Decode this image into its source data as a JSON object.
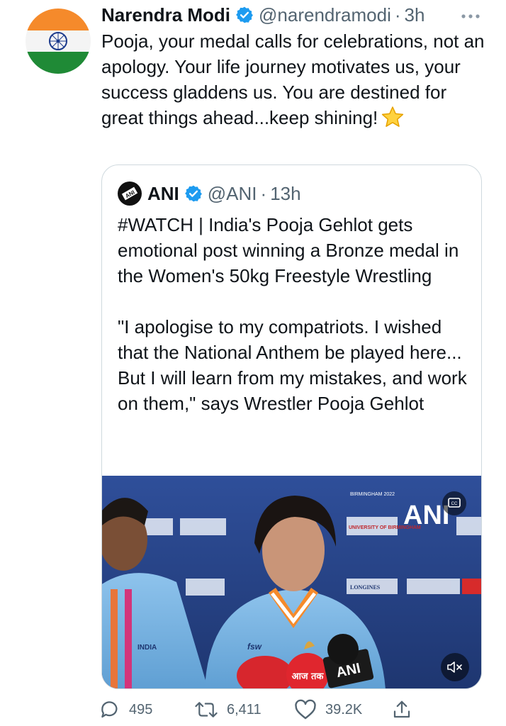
{
  "author": {
    "name": "Narendra Modi",
    "handle": "@narendramodi",
    "separator": "·",
    "time": "3h",
    "more_icon": "ellipsis-icon",
    "avatar": "india-flag-avatar"
  },
  "tweet": {
    "text": "Pooja, your medal calls for celebrations, not an apology. Your life journey motivates us, your success gladdens us. You are destined for great things ahead...keep shining!",
    "emoji": "star-emoji"
  },
  "quote": {
    "name": "ANI",
    "handle": "@ANI",
    "separator": "·",
    "time": "13h",
    "paragraph1": "#WATCH | India's Pooja Gehlot gets emotional post winning a Bronze medal in the Women's 50kg Freestyle Wrestling",
    "paragraph2": "\"I apologise to my compatriots. I wished that the National Anthem be played here... But I will learn from my mistakes, and work on them,\" says Wrestler Pooja Gehlot",
    "media": {
      "watermark": "ANI",
      "mic_label": "ANI",
      "mic_label_2": "आज तक",
      "backdrop_texts": [
        "BIRMINGHAM 2022",
        "UNIVERSITY OF BIRMINGHAM",
        "LONGINES",
        "INDIA",
        "fsw"
      ],
      "captions_icon": "closed-captions-icon",
      "mute_icon": "volume-muted-icon"
    }
  },
  "actions": {
    "replies": "495",
    "retweets": "6,411",
    "likes": "39.2K",
    "share_icon": "share-icon"
  },
  "colors": {
    "text": "#0f1419",
    "secondary": "#536471",
    "verified": "#1d9bf0",
    "border": "#cfd9de"
  }
}
